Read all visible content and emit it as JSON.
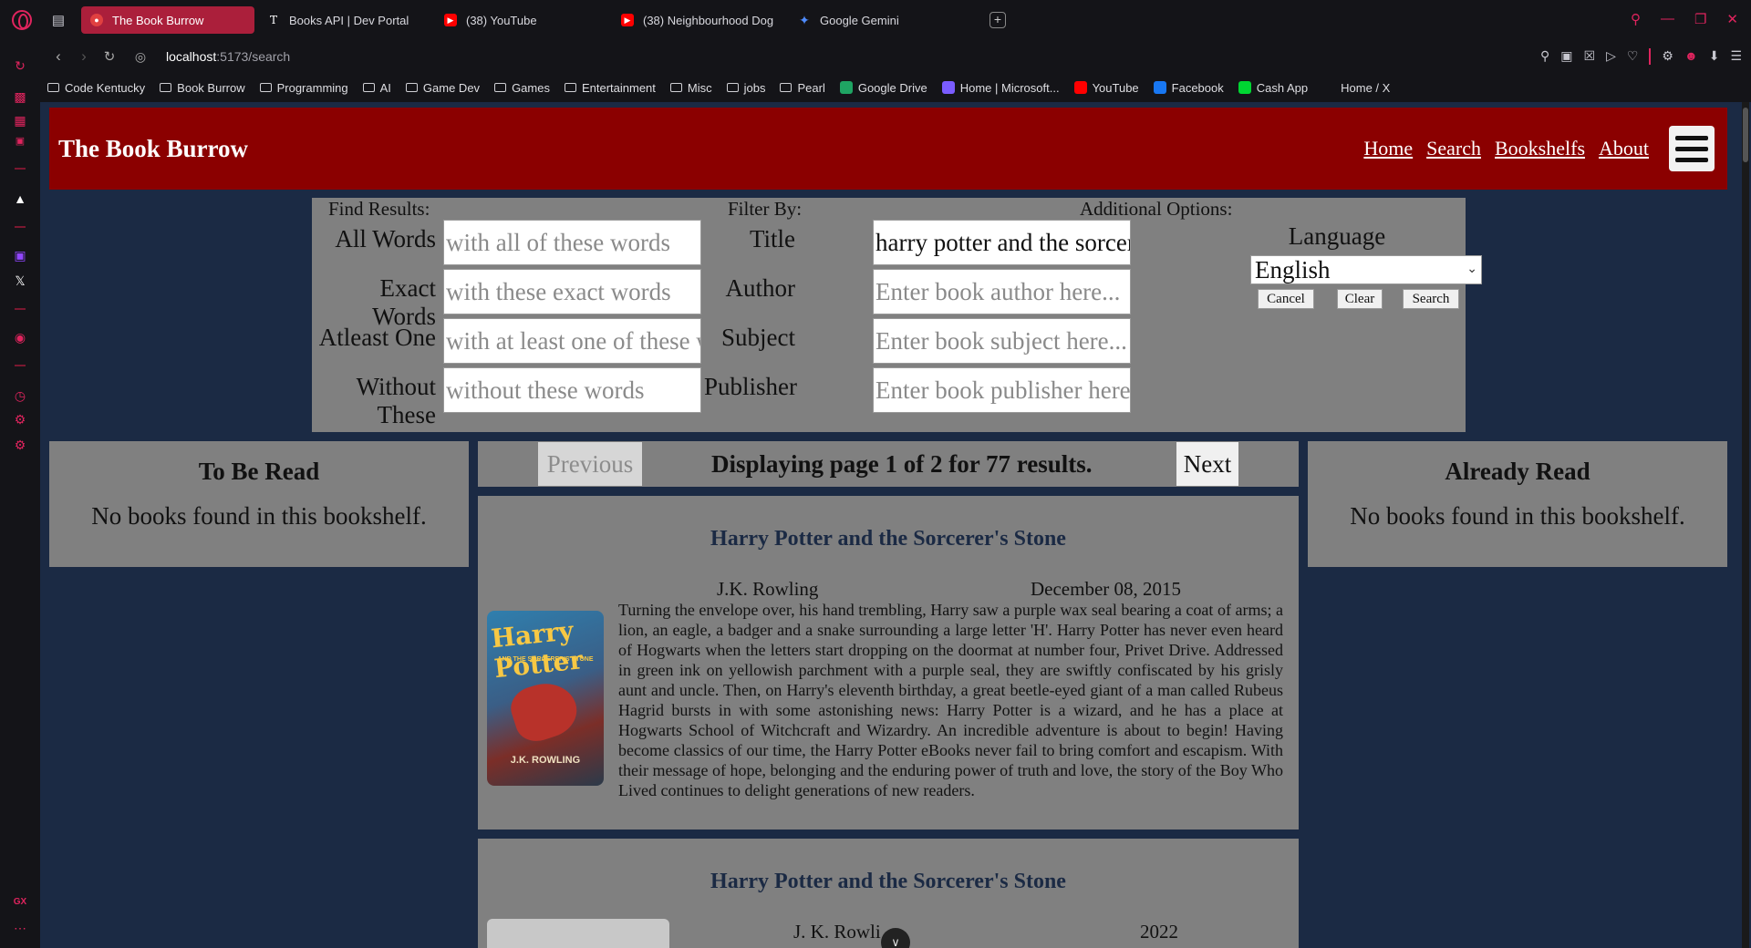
{
  "browser": {
    "tabs": [
      {
        "label": "The Book Burrow",
        "active": true,
        "icon": "book-burrow-favicon",
        "color": "#e04040"
      },
      {
        "label": "Books API | Dev Portal",
        "active": false,
        "icon": "nyt-favicon",
        "color": "#ffffff"
      },
      {
        "label": "(38) YouTube",
        "active": false,
        "icon": "youtube-favicon",
        "color": "#ff0000"
      },
      {
        "label": "(38) Neighbourhood Dog",
        "active": false,
        "icon": "youtube-favicon",
        "color": "#ff0000"
      },
      {
        "label": "Google Gemini",
        "active": false,
        "icon": "gemini-favicon",
        "color": "#4f8cff"
      }
    ],
    "new_tab_label": "+",
    "url_host": "localhost",
    "url_path": ":5173/search",
    "bookmarks": [
      {
        "label": "Code Kentucky",
        "type": "folder"
      },
      {
        "label": "Book Burrow",
        "type": "folder"
      },
      {
        "label": "Programming",
        "type": "folder"
      },
      {
        "label": "AI",
        "type": "folder"
      },
      {
        "label": "Game Dev",
        "type": "folder"
      },
      {
        "label": "Games",
        "type": "folder"
      },
      {
        "label": "Entertainment",
        "type": "folder"
      },
      {
        "label": "Misc",
        "type": "folder"
      },
      {
        "label": "jobs",
        "type": "folder"
      },
      {
        "label": "Pearl",
        "type": "folder"
      },
      {
        "label": "Google Drive",
        "type": "site",
        "color": "#1fa463"
      },
      {
        "label": "Home | Microsoft...",
        "type": "site",
        "color": "#7a5cff"
      },
      {
        "label": "YouTube",
        "type": "site",
        "color": "#ff0000"
      },
      {
        "label": "Facebook",
        "type": "site",
        "color": "#1877f2"
      },
      {
        "label": "Cash App",
        "type": "site",
        "color": "#00d632"
      },
      {
        "label": "Home / X",
        "type": "site",
        "color": "#141418"
      }
    ],
    "accent_color": "#e0245e"
  },
  "site": {
    "title": "The Book Burrow",
    "nav": [
      "Home",
      "Search",
      "Bookshelfs",
      "About"
    ],
    "header_color": "#8b0000"
  },
  "search": {
    "find_results_label": "Find Results:",
    "filter_by_label": "Filter By:",
    "additional_options_label": "Additional Options:",
    "find_fields": [
      {
        "label": "All Words",
        "value": "",
        "placeholder": "with all of these words"
      },
      {
        "label": "Exact Words",
        "value": "",
        "placeholder": "with these exact words"
      },
      {
        "label": "Atleast One",
        "value": "",
        "placeholder": "with at least one of these word"
      },
      {
        "label": "Without These",
        "value": "",
        "placeholder": "without these words"
      }
    ],
    "filter_fields": [
      {
        "label": "Title",
        "value": "harry potter and the sorcerer's",
        "placeholder": ""
      },
      {
        "label": "Author",
        "value": "",
        "placeholder": "Enter book author here..."
      },
      {
        "label": "Subject",
        "value": "",
        "placeholder": "Enter book subject here..."
      },
      {
        "label": "Publisher",
        "value": "",
        "placeholder": "Enter book publisher here..."
      }
    ],
    "language_label": "Language",
    "language_value": "English",
    "buttons": {
      "cancel": "Cancel",
      "clear": "Clear",
      "search": "Search"
    }
  },
  "shelves": {
    "to_be_read": {
      "title": "To Be Read",
      "empty_text": "No books found in this bookshelf."
    },
    "already_read": {
      "title": "Already Read",
      "empty_text": "No books found in this bookshelf."
    }
  },
  "pager": {
    "previous": "Previous",
    "next": "Next",
    "info": "Displaying page 1 of 2 for 77 results."
  },
  "results": [
    {
      "title": "Harry Potter and the Sorcerer's Stone",
      "author": "J.K. Rowling",
      "date": "December 08, 2015",
      "cover_title": "Harry Potter",
      "cover_subtitle": "AND THE SORCERER'S STONE",
      "cover_author": "J.K. ROWLING",
      "description": "Turning the envelope over, his hand trembling, Harry saw a purple wax seal bearing a coat of arms; a lion, an eagle, a badger and a snake surrounding a large letter 'H'. Harry Potter has never even heard of Hogwarts when the letters start dropping on the doormat at number four, Privet Drive. Addressed in green ink on yellowish parchment with a purple seal, they are swiftly confiscated by his grisly aunt and uncle. Then, on Harry's eleventh birthday, a great beetle-eyed giant of a man called Rubeus Hagrid bursts in with some astonishing news: Harry Potter is a wizard, and he has a place at Hogwarts School of Witchcraft and Wizardry. An incredible adventure is about to begin! Having become classics of our time, the Harry Potter eBooks never fail to bring comfort and escapism. With their message of hope, belonging and the enduring power of truth and love, the story of the Boy Who Lived continues to delight generations of new readers."
    },
    {
      "title": "Harry Potter and the Sorcerer's Stone",
      "author": "J. K. Rowli",
      "date": "2022",
      "description": ""
    }
  ]
}
